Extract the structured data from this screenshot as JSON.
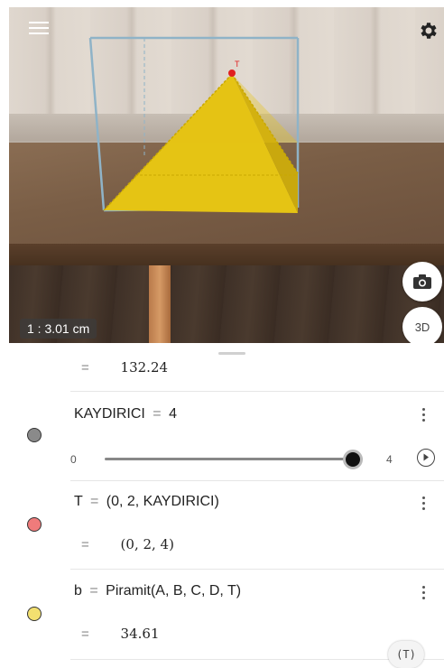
{
  "ar_view": {
    "scale_label": "1 : 3.01 cm",
    "view3d_label": "3D",
    "point_label": "T",
    "icons": {
      "menu": "menu-icon",
      "settings": "gear-icon",
      "camera": "camera-icon"
    },
    "colors": {
      "pyramid": "#e5c414",
      "box_edges": "#8fb3c7",
      "point": "#e02020"
    }
  },
  "algebra": {
    "partial_row": {
      "equals": "=",
      "value": "132.24"
    },
    "slider_row": {
      "name": "KAYDIRICI",
      "equals": "=",
      "value": "4",
      "min_label": "0",
      "max_label": "4",
      "level": 1.0,
      "dot_color": "#8a8a8a"
    },
    "point_row": {
      "name": "T",
      "equals": "=",
      "definition": "(0, 2, KAYDIRICI)",
      "output_equals": "=",
      "output": "(0, 2, 4)",
      "dot_color": "#ef7b7b"
    },
    "pyramid_row": {
      "name": "b",
      "equals": "=",
      "definition": "Piramit(A, B, C, D, T)",
      "output_equals": "=",
      "output": "34.61",
      "dot_color": "#f3e070"
    },
    "text_tool_label": "(T)"
  }
}
